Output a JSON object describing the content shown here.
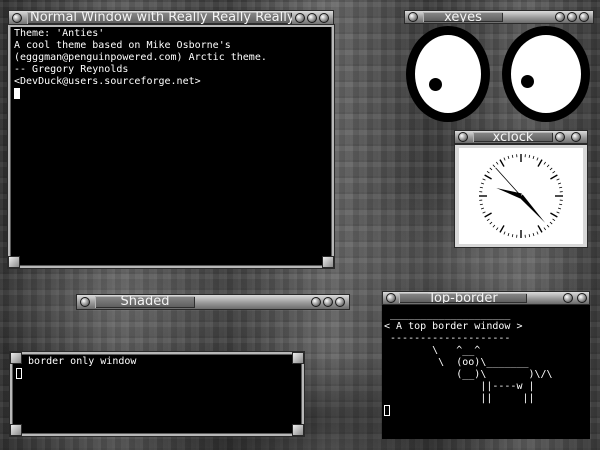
{
  "windows": {
    "normal": {
      "title": "Normal Window with Really Really Really Long Title",
      "lines": [
        "Theme: 'Anties'",
        "A cool theme based on Mike Osborne's",
        "(egggman@penguinpowered.com) Arctic theme.",
        "",
        "-- Gregory Reynolds",
        "<DevDuck@users.sourceforge.net>"
      ]
    },
    "xeyes": {
      "title": "xeyes"
    },
    "xclock": {
      "title": "xclock",
      "hour": 9.6,
      "minute": 23,
      "second": 53
    },
    "shaded": {
      "title": "Shaded"
    },
    "border_only": {
      "text": "A border only window"
    },
    "top_border": {
      "title": "Top-border",
      "lines": [
        " ____________________",
        "< A top border window >",
        " --------------------",
        "        \\   ^__^",
        "         \\  (oo)\\_______",
        "            (__)\\       )\\/\\",
        "                ||----w |",
        "                ||     ||"
      ]
    }
  }
}
